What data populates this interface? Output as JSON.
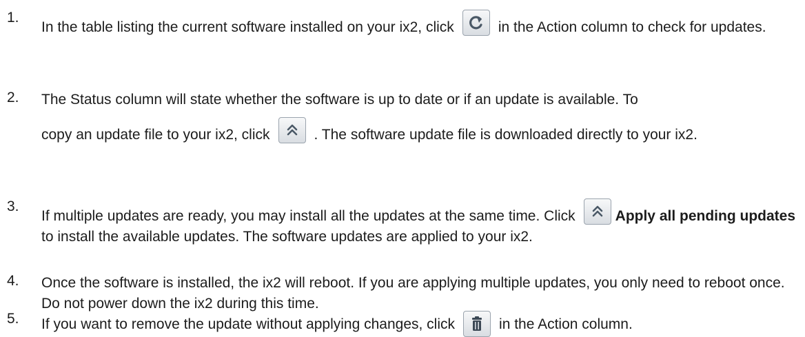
{
  "steps": [
    {
      "number": "1.",
      "before": "In the table listing the current software installed on your ix2, click",
      "icon": "refresh-icon",
      "after": "in the Action column to check for updates."
    },
    {
      "number": "2.",
      "line1": "The Status column will state whether the software is up to date or if an update is available. To",
      "before": "copy an update file to your ix2, click",
      "icon": "update-icon",
      "after": ". The software update file is downloaded directly to your ix2."
    },
    {
      "number": "3.",
      "before": "If multiple updates are ready, you may install all the updates at the same time. Click",
      "icon": "update-icon",
      "bold": "Apply all pending updates",
      "after": "to install the available updates. The software updates are applied to your ix2."
    },
    {
      "number": "4.",
      "text": "Once the software is installed, the ix2 will reboot. If you are applying multiple updates, you only need to reboot once. Do not power down the ix2 during this time."
    },
    {
      "number": "5.",
      "before": "If you want to remove the update without applying changes, click",
      "icon": "trash-icon",
      "after": "in the Action column."
    }
  ]
}
